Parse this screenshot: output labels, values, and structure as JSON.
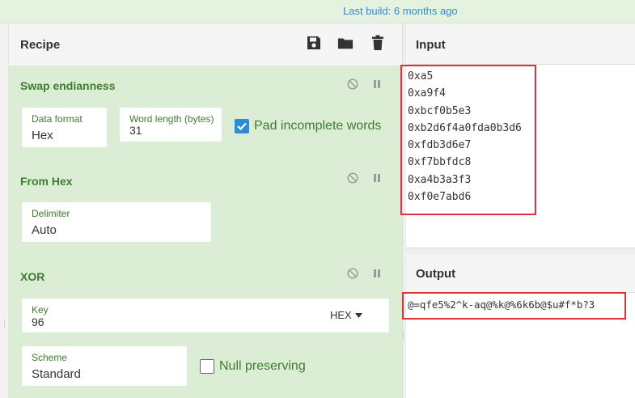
{
  "topbar": {
    "build_text": "Last build: 6 months ago"
  },
  "recipe": {
    "title": "Recipe",
    "header_icons": [
      "save-icon",
      "folder-icon",
      "trash-icon"
    ],
    "operations": [
      {
        "title": "Swap endianness",
        "fields": [
          {
            "label": "Data format",
            "value": "Hex"
          },
          {
            "label": "Word length (bytes)",
            "value": "31"
          }
        ],
        "checkbox": {
          "label": "Pad incomplete words",
          "checked": true
        }
      },
      {
        "title": "From Hex",
        "fields": [
          {
            "label": "Delimiter",
            "value": "Auto"
          }
        ]
      },
      {
        "title": "XOR",
        "fields": [
          {
            "label": "Key",
            "value": "96",
            "dropdown": "HEX"
          },
          {
            "label": "Scheme",
            "value": "Standard"
          }
        ],
        "checkbox": {
          "label": "Null preserving",
          "checked": false
        }
      }
    ],
    "op_icons": [
      "disable-icon",
      "pause-icon"
    ]
  },
  "input": {
    "title": "Input",
    "lines": [
      "0xa5",
      "0xa9f4",
      "0xbcf0b5e3",
      "0xb2d6f4a0fda0b3d6",
      "0xfdb3d6e7",
      "0xf7bbfdc8",
      "0xa4b3a3f3",
      "0xf0e7abd6"
    ]
  },
  "output": {
    "title": "Output",
    "text": "@=qfe5%2^k-aq@%k@%6k6b@$u#f*b?3"
  },
  "colors": {
    "accent_green": "#3e7c30",
    "op_bg": "#dcedd5",
    "highlight_red": "#e0313b",
    "link_blue": "#2f8bd6"
  }
}
